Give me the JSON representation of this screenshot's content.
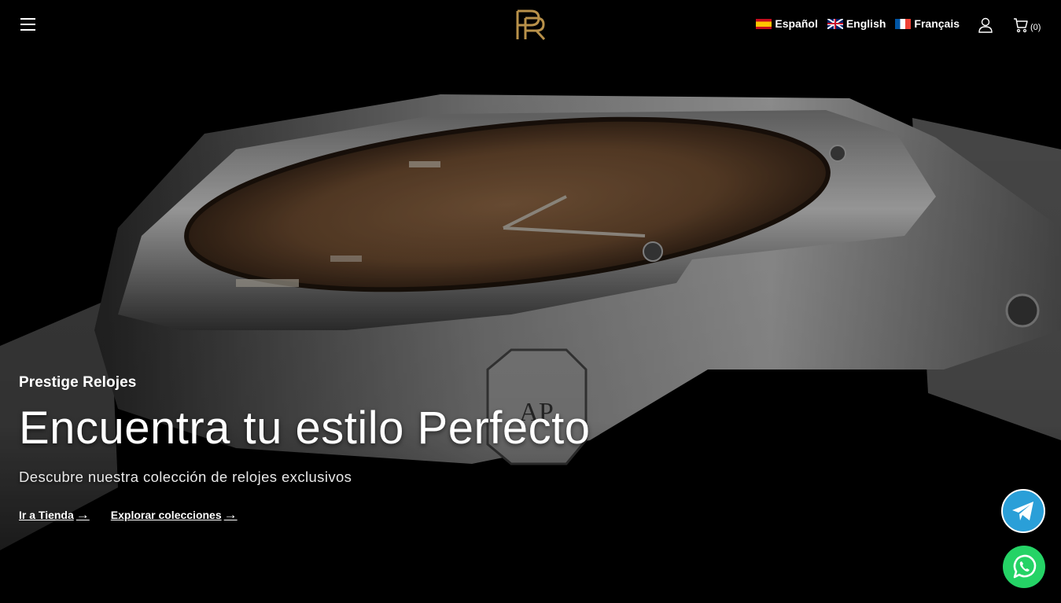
{
  "header": {
    "menu_icon": "hamburger-menu-icon",
    "logo_icon": "pr-monogram-logo",
    "languages": [
      {
        "label": "Español",
        "flag": "spain-flag-icon"
      },
      {
        "label": "English",
        "flag": "uk-flag-icon"
      },
      {
        "label": "Français",
        "flag": "france-flag-icon"
      }
    ],
    "account_icon": "user-icon",
    "cart_icon": "shopping-cart-icon",
    "cart_count": "(0)"
  },
  "hero": {
    "eyebrow": "Prestige Relojes",
    "headline": "Encuentra tu estilo Perfecto",
    "subhead": "Descubre nuestra colección de relojes exclusivos",
    "cta_shop": "Ir a Tienda",
    "cta_collections": "Explorar colecciones",
    "arrow": "→"
  },
  "floating": {
    "telegram_icon": "telegram-icon",
    "whatsapp_icon": "whatsapp-icon"
  },
  "colors": {
    "logo_gold": "#b8914a",
    "telegram_blue": "#2a9fd8",
    "whatsapp_green": "#25d366",
    "dial_brown": "#6b4a2f"
  }
}
